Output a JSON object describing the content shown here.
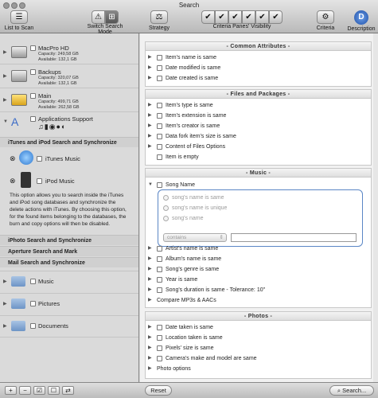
{
  "window": {
    "title": "Search"
  },
  "toolbar": {
    "list_to_scan": "List to Scan",
    "switch_search_mode": "Switch Search Mode",
    "strategy": "Strategy",
    "criteria_visibility": "Criteria Panes' Visibility",
    "criteria": "Criteria",
    "description": "Description"
  },
  "sidebar": {
    "volumes": [
      {
        "name": "MacPro HD",
        "capacity": "Capacity: 249,58 GB",
        "available": "Available: 132,1 GB"
      },
      {
        "name": "Backups",
        "capacity": "Capacity: 320,07 GB",
        "available": "Available: 132,1 GB"
      },
      {
        "name": "Main",
        "capacity": "Capacity: 499,71 GB",
        "available": "Available: 262,58 GB"
      }
    ],
    "apps_support": "Applications Support",
    "itunes_heading": "iTunes and iPod Search and Synchronize",
    "itunes_music": "iTunes Music",
    "ipod_music": "iPod Music",
    "info_text": "This option allows you to search inside the iTunes and iPod song databases and synchronize the delete actions with iTunes. By choosing this option, for the found items belonging to the databases, the burn and copy options will then be disabled.",
    "iphoto": "iPhoto Search and Synchronize",
    "aperture": "Aperture Search and Mark",
    "mail": "Mail Search and Synchronize",
    "folders": [
      "Music",
      "Pictures",
      "Documents"
    ]
  },
  "bottom": {
    "add": "+",
    "remove": "−",
    "reset": "Reset",
    "search": "Search..."
  },
  "sections": {
    "common": {
      "title": "- Common Attributes -",
      "items": [
        "Item's name is same",
        "Date modified is same",
        "Date created is same"
      ]
    },
    "files": {
      "title": "- Files and Packages -",
      "items": [
        "Item's type is same",
        "Item's extension is same",
        "Item's creator is same",
        "Data fork item's size is same",
        "Content of Files Options",
        "Item is empty"
      ]
    },
    "music": {
      "title": "- Music -",
      "song_name": "Song Name",
      "radios": [
        "song's name is same",
        "song's name is unique",
        "song's name"
      ],
      "popup": "contains",
      "items": [
        "Artist's name is same",
        "Album's name is same",
        "Song's genre is same",
        "Year is same",
        "Song's duration is same - Tolerance: 10\""
      ],
      "compare": "Compare MP3s & AACs"
    },
    "photos": {
      "title": "- Photos -",
      "items": [
        "Date taken is same",
        "Location taken is same",
        "Pixels' size is same",
        "Camera's make and model are same"
      ],
      "options": "Photo options"
    }
  }
}
